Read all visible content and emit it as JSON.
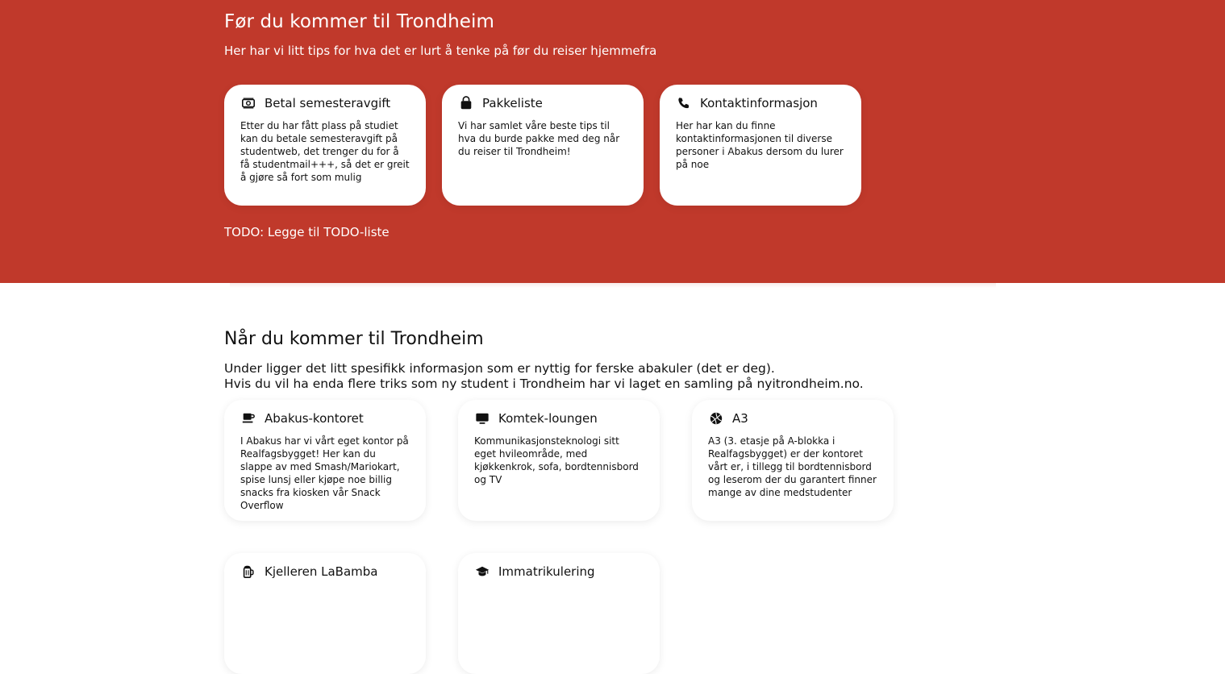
{
  "before": {
    "title": "Før du kommer til Trondheim",
    "subtitle": "Her har vi litt tips for hva det er lurt å tenke på før du reiser hjemmefra",
    "todo": "TODO: Legge til TODO-liste",
    "background_color": "#c0392b",
    "cards": [
      {
        "icon": "money-icon",
        "title": "Betal semesteravgift",
        "text": "Etter du har fått plass på studiet kan du betale semesteravgift på studentweb, det trenger du for å få studentmail+++, så det er greit å gjøre så fort som mulig"
      },
      {
        "icon": "shopping-bag-icon",
        "title": "Pakkeliste",
        "text": "Vi har samlet våre beste tips til hva du burde pakke med deg når du reiser til Trondheim!"
      },
      {
        "icon": "phone-icon",
        "title": "Kontaktinformasjon",
        "text": "Her har kan du finne kontaktinformasjonen til diverse personer i Abakus dersom du lurer på noe"
      }
    ]
  },
  "arrival": {
    "title": "Når du kommer til Trondheim",
    "line1": "Under ligger det litt spesifikk informasjon som er nyttig for ferske abakuler (det er deg).",
    "line2": "Hvis du vil ha enda flere triks som ny student i Trondheim har vi laget en samling på nyitrondheim.no.",
    "cards": [
      {
        "icon": "coffee-icon",
        "title": "Abakus-kontoret",
        "text": "I Abakus har vi vårt eget kontor på Realfagsbygget! Her kan du slappe av med Smash/Mariokart, spise lunsj eller kjøpe noe billig snacks fra kiosken vår Snack Overflow"
      },
      {
        "icon": "tv-icon",
        "title": "Komtek-loungen",
        "text": "Kommunikasjonsteknologi sitt eget hvileområde, med kjøkkenkrok, sofa, bordtennisbord og TV"
      },
      {
        "icon": "ball-icon",
        "title": "A3",
        "text": "A3 (3. etasje på A-blokka i Realfagsbygget) er der kontoret vårt er, i tillegg til bordtennisbord og leserom der du garantert finner mange av dine medstudenter"
      },
      {
        "icon": "beer-icon",
        "title": "Kjelleren LaBamba",
        "text": ""
      },
      {
        "icon": "graduation-cap-icon",
        "title": "Immatrikulering",
        "text": ""
      }
    ]
  }
}
